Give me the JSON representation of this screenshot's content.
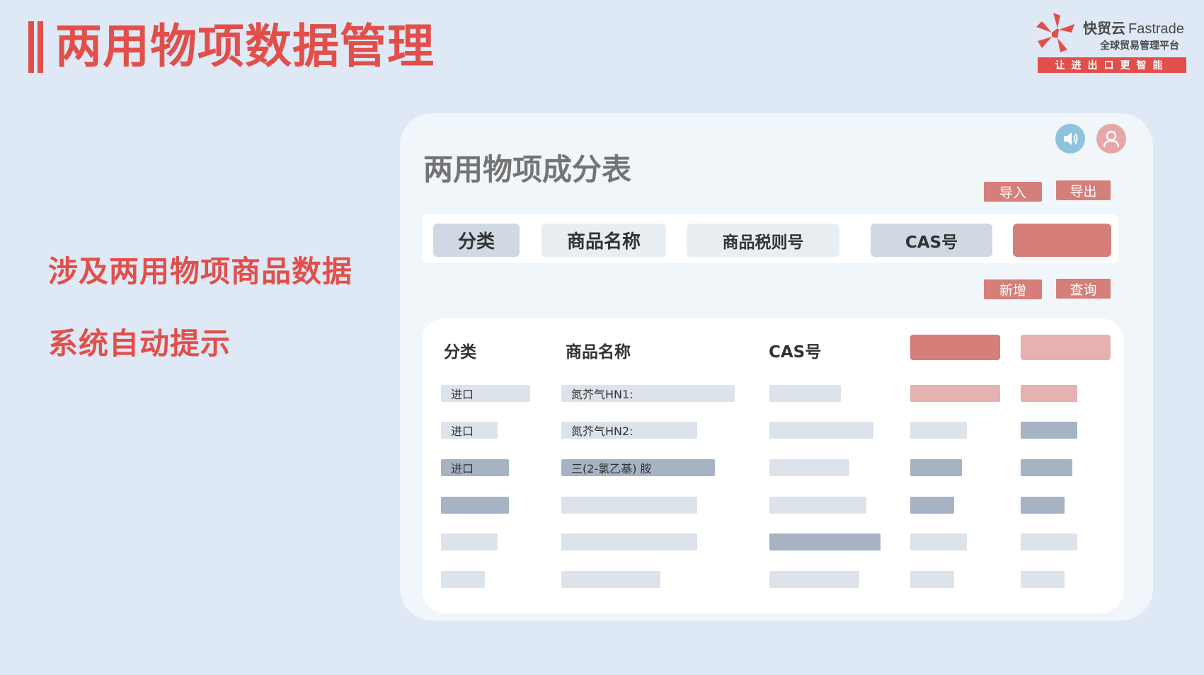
{
  "header": {
    "title": "两用物项数据管理"
  },
  "logo": {
    "brand_cn": "快贸云",
    "brand_en": "Fastrade",
    "subtitle": "全球贸易管理平台",
    "slogan": "让进出口更智能"
  },
  "features": {
    "line1": "涉及两用物项商品数据",
    "line2": "系统自动提示"
  },
  "panel": {
    "title": "两用物项成分表",
    "import_label": "导入",
    "export_label": "导出",
    "add_label": "新增",
    "query_label": "查询",
    "filters": {
      "category": "分类",
      "name": "商品名称",
      "tariff": "商品税则号",
      "cas": "CAS号"
    },
    "table": {
      "headers": {
        "category": "分类",
        "name": "商品名称",
        "cas": "CAS号"
      },
      "rows": [
        {
          "category": "进口",
          "name": "氮芥气HN1:"
        },
        {
          "category": "进口",
          "name": "氮芥气HN2:"
        },
        {
          "category": "进口",
          "name": "三(2-氯乙基) 胺"
        }
      ]
    }
  },
  "colors": {
    "accent": "#e24f4b",
    "button": "#d67e79",
    "panel_bg": "#f1f6fa",
    "page_bg": "#dfe9f5"
  }
}
